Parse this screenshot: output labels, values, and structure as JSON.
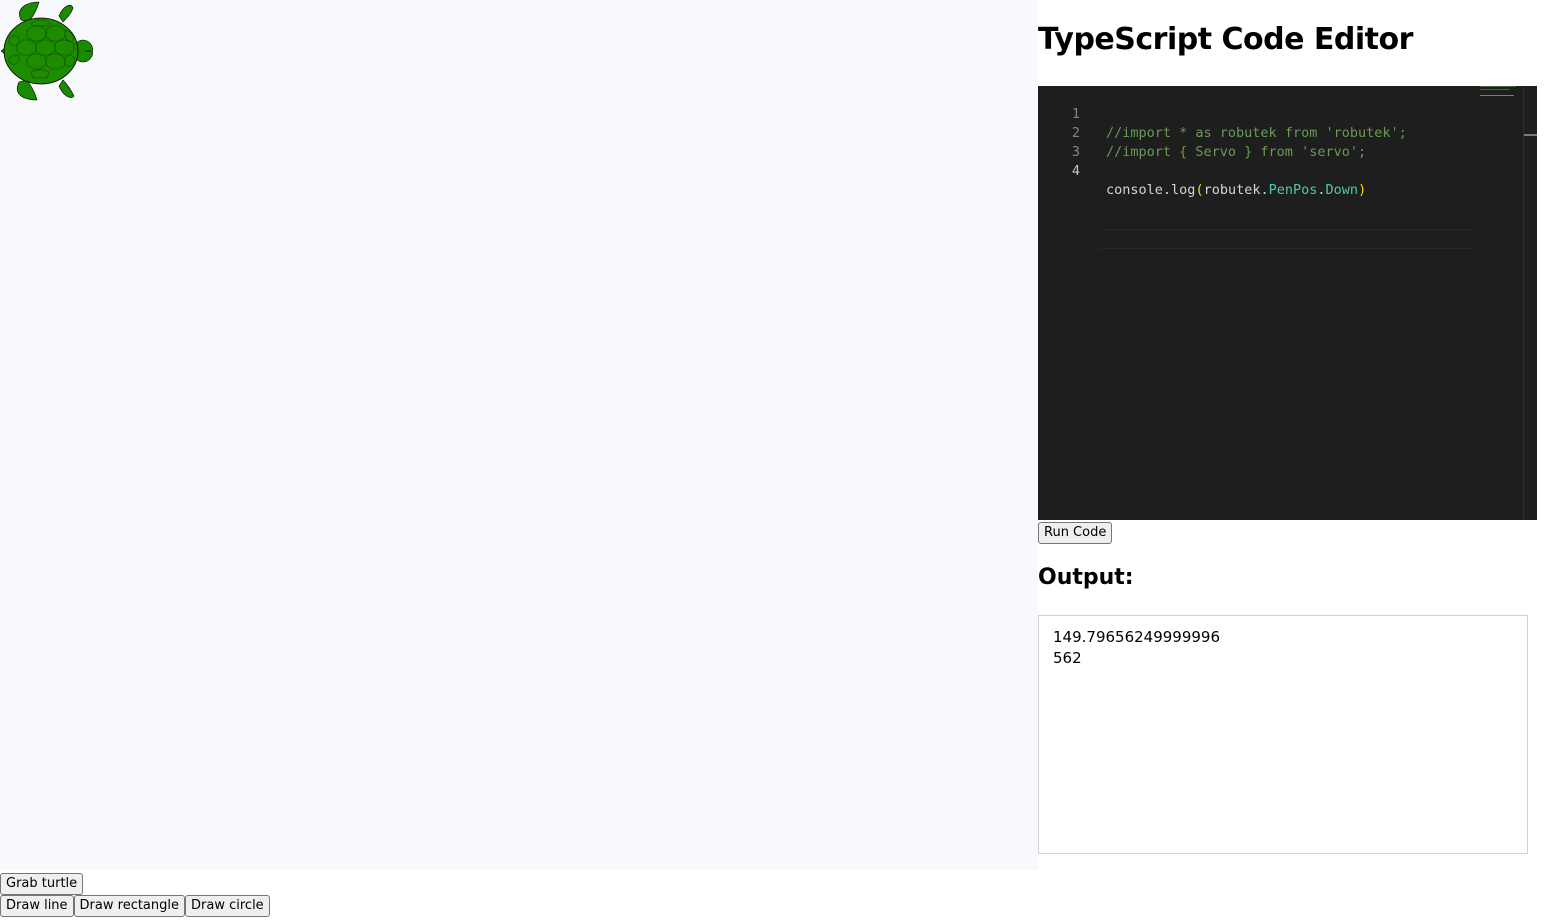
{
  "canvas": {
    "turtle_icon": "turtle-icon",
    "background_color": "#f8f9fd"
  },
  "controls": {
    "grab_turtle": "Grab turtle",
    "draw_line": "Draw line",
    "draw_rectangle": "Draw rectangle",
    "draw_circle": "Draw circle"
  },
  "editor": {
    "title": "TypeScript Code Editor",
    "lines": [
      {
        "number": "1",
        "comment": "//import * as robutek from 'robutek';"
      },
      {
        "number": "2",
        "comment": "//import { Servo } from 'servo';"
      },
      {
        "number": "3"
      },
      {
        "number": "4",
        "tokens": {
          "console": "console",
          "dot1": ".",
          "log": "log",
          "lparen": "(",
          "robutek": "robutek",
          "dot2": ".",
          "penpos": "PenPos",
          "dot3": ".",
          "down": "Down",
          "rparen": ")"
        }
      }
    ],
    "background_color": "#1e1e1e",
    "comment_color": "#6a9955",
    "type_color": "#4ec9b0"
  },
  "run": {
    "label": "Run Code"
  },
  "output": {
    "title": "Output:",
    "lines": [
      "149.79656249999996",
      "562"
    ]
  }
}
